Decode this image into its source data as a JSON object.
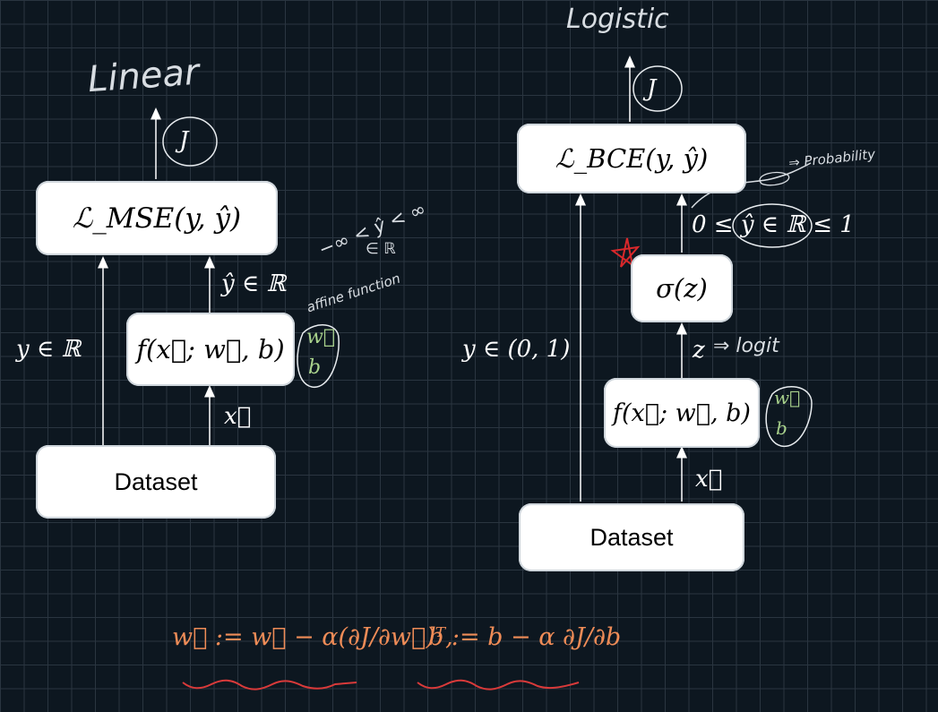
{
  "linear": {
    "title": "Linear",
    "loss_box": "ℒ_MSE(y, ŷ)",
    "model_box": "f(x⃗; w⃗, b)",
    "dataset_box": "Dataset",
    "cost": "J",
    "y_label": "y ∈ ℝ",
    "yhat_label": "ŷ ∈ ℝ",
    "x_label": "x⃗",
    "note_range": "−∞ < ŷ < ∞",
    "note_in_r": "∈ ℝ",
    "note_affine": "affine function",
    "params_w": "w⃗",
    "params_b": "b"
  },
  "logistic": {
    "title": "Logistic",
    "loss_box": "ℒ_BCE(y, ŷ)",
    "sigma_box": "σ(z)",
    "model_box": "f(x⃗; w⃗, b)",
    "dataset_box": "Dataset",
    "cost": "J",
    "y_label": "y ∈ (0, 1)",
    "yhat_label": "0 ≤ ŷ ∈ ℝ ≤ 1",
    "z_label": "z",
    "note_logit": "⇒ logit",
    "note_probability": "⇒ Probability",
    "x_label": "x⃗",
    "params_w": "w⃗",
    "params_b": "b"
  },
  "update_rule": {
    "w_update": "w⃗ := w⃗ − α(∂J/∂w⃗)ᵀ,",
    "b_update": "b := b − α ∂J/∂b"
  },
  "colors": {
    "background": "#0d1720",
    "grid": "#2a3540",
    "box": "#ffffff",
    "arrow": "#ffffff",
    "formula": "#ef8c57",
    "params": "#a9d28c",
    "star": "#d9282b"
  }
}
